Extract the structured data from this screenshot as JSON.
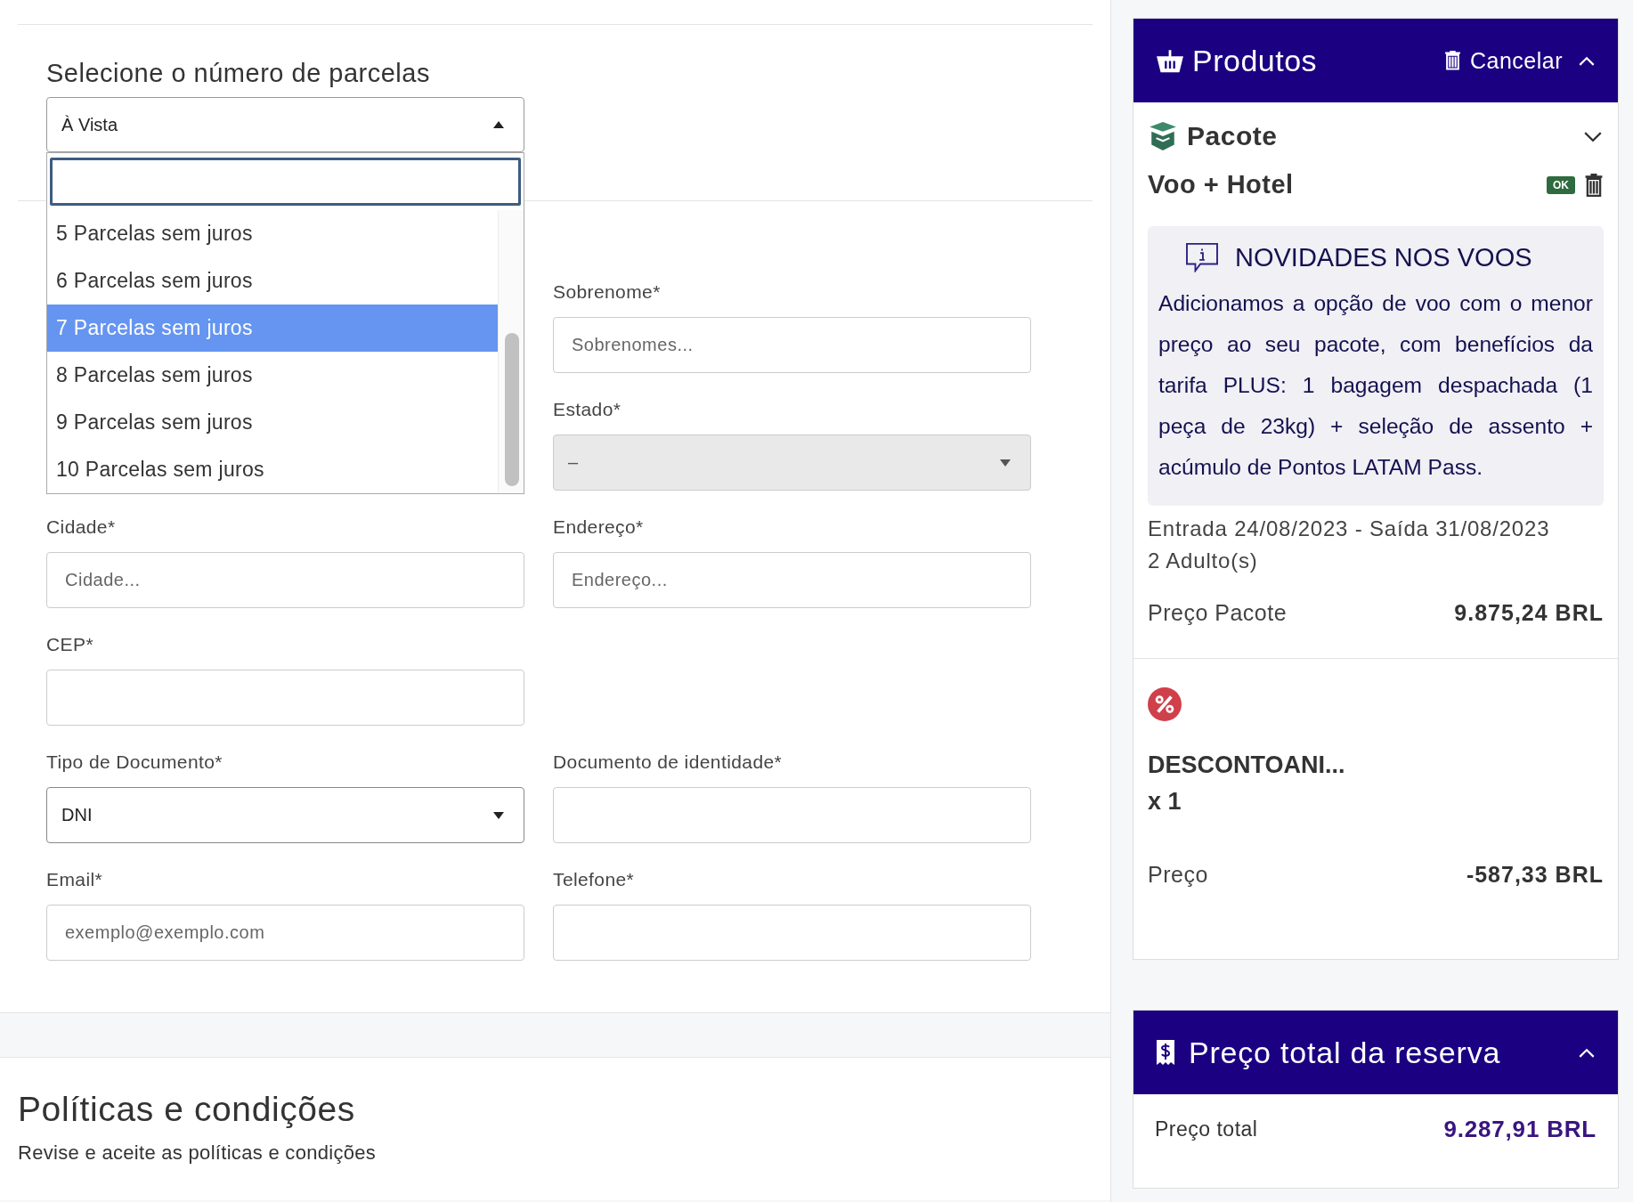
{
  "installments": {
    "label": "Selecione o número de parcelas",
    "value": "À Vista",
    "expanded": true,
    "options": [
      {
        "label": "5 Parcelas sem juros",
        "selected": false
      },
      {
        "label": "6 Parcelas sem juros",
        "selected": false
      },
      {
        "label": "7 Parcelas sem juros",
        "selected": true
      },
      {
        "label": "8 Parcelas sem juros",
        "selected": false
      },
      {
        "label": "9 Parcelas sem juros",
        "selected": false
      },
      {
        "label": "10 Parcelas sem juros",
        "selected": false
      }
    ]
  },
  "form_rows": [
    {
      "right": {
        "label": "Sobrenome*",
        "kind": "input",
        "placeholder": "Sobrenomes..."
      }
    },
    {
      "right": {
        "label": "Estado*",
        "kind": "select",
        "value": "–",
        "disabled": true
      }
    },
    {
      "left": {
        "label": "Cidade*",
        "kind": "input",
        "placeholder": "Cidade..."
      },
      "right": {
        "label": "Endereço*",
        "kind": "input",
        "placeholder": "Endereço..."
      }
    },
    {
      "left": {
        "label": "CEP*",
        "kind": "input"
      }
    },
    {
      "left": {
        "label": "Tipo de Documento*",
        "kind": "select",
        "value": "DNI",
        "disabled": false
      },
      "right": {
        "label": "Documento de identidade*",
        "kind": "input"
      }
    },
    {
      "left": {
        "label": "Email*",
        "kind": "input",
        "placeholder": "exemplo@exemplo.com"
      },
      "right": {
        "label": "Telefone*",
        "kind": "input"
      }
    }
  ],
  "policies": {
    "title": "Políticas e condições",
    "subtitle": "Revise e aceite as políticas e condições"
  },
  "products": {
    "title": "Produtos",
    "cancel": "Cancelar",
    "package": {
      "title": "Pacote",
      "name": "Voo + Hotel",
      "badge": "OK",
      "notice": {
        "title": "NOVIDADES NOS VOOS",
        "text": "Adicionamos a opção de voo com o menor preço ao seu pacote, com benefícios da tarifa PLUS: 1 bagagem despachada (1 peça de 23kg) + seleção de assento + acúmulo de Pontos LATAM Pass."
      },
      "dates": "Entrada 24/08/2023 - Saída 31/08/2023",
      "guests": "2 Adulto(s)",
      "price_label": "Preço Pacote",
      "price": "9.875,24 BRL"
    },
    "discount": {
      "name": "DESCONTOANI...",
      "quantity": "x 1",
      "price_label": "Preço",
      "price": "-587,33 BRL"
    }
  },
  "total": {
    "title": "Preço total da reserva",
    "label": "Preço total",
    "value": "9.287,91 BRL"
  }
}
